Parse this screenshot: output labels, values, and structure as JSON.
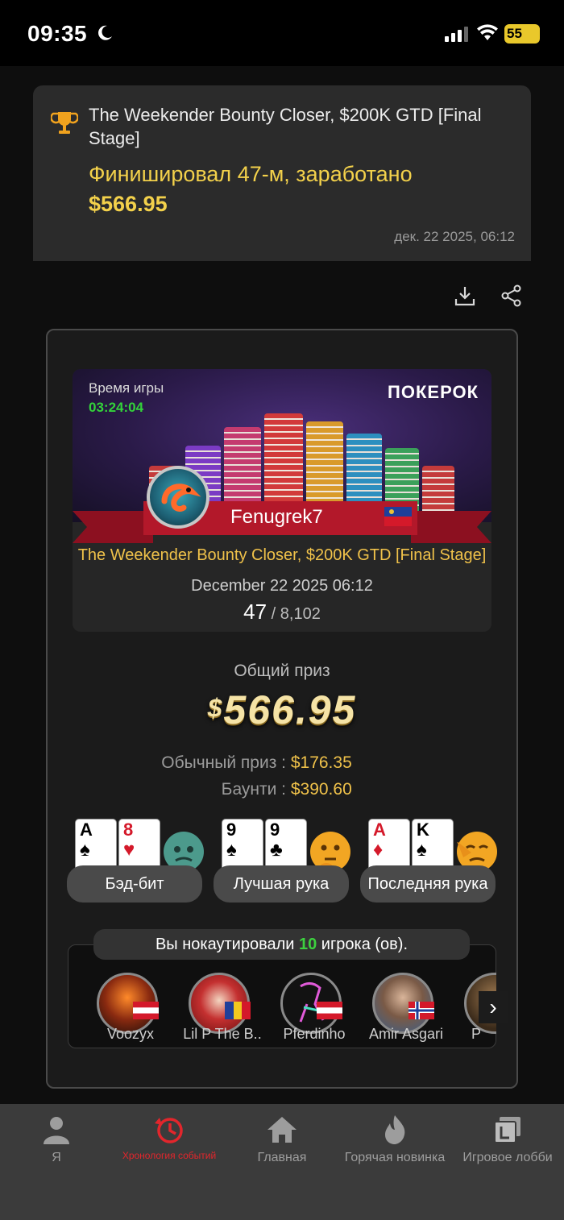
{
  "status_bar": {
    "time": "09:35",
    "battery": "55"
  },
  "notice": {
    "title": "The Weekender Bounty Closer, $200K GTD [Final Stage]",
    "result_text": "Финишировал 47-м, заработано",
    "result_amount": "$566.95",
    "date": "дек. 22 2025, 06:12"
  },
  "banner": {
    "playtime_label": "Время игры",
    "playtime": "03:24:04",
    "logo": "ПОКЕРОК",
    "player_name": "Fenugrek7",
    "tournament": "The Weekender Bounty Closer, $200K GTD [Final Stage]",
    "date": "December 22 2025 06:12",
    "place": "47",
    "field": " / 8,102"
  },
  "prize": {
    "label": "Общий приз",
    "currency": "$",
    "amount": "566.95",
    "regular_label": "Обычный приз :",
    "regular_value": "$176.35",
    "bounty_label": "Баунти :",
    "bounty_value": "$390.60"
  },
  "hands": [
    {
      "label": "Бэд-бит",
      "cards": [
        {
          "rank": "A",
          "suit": "♠",
          "red": false
        },
        {
          "rank": "8",
          "suit": "♥",
          "red": true
        }
      ]
    },
    {
      "label": "Лучшая рука",
      "cards": [
        {
          "rank": "9",
          "suit": "♠",
          "red": false
        },
        {
          "rank": "9",
          "suit": "♣",
          "red": false
        }
      ]
    },
    {
      "label": "Последняя рука",
      "cards": [
        {
          "rank": "A",
          "suit": "♦",
          "red": true
        },
        {
          "rank": "K",
          "suit": "♠",
          "red": false
        }
      ]
    }
  ],
  "knockouts": {
    "prefix": "Вы нокаутировали ",
    "count": "10",
    "suffix": " игрока (ов).",
    "players": [
      {
        "name": "Voozyx",
        "flag": "austria"
      },
      {
        "name": "Lil P The B..",
        "flag": "andorra"
      },
      {
        "name": "Pferdinho",
        "flag": "austria"
      },
      {
        "name": "Amir Asgari",
        "flag": "norway"
      },
      {
        "name": "P",
        "flag": ""
      }
    ]
  },
  "tabs": [
    {
      "label": "Я",
      "icon": "person-icon"
    },
    {
      "label": "Хронология событий",
      "icon": "history-icon",
      "active": true
    },
    {
      "label": "Главная",
      "icon": "home-icon"
    },
    {
      "label": "Горячая новинка",
      "icon": "fire-icon"
    },
    {
      "label": "Игровое лобби",
      "icon": "lobby-icon"
    }
  ],
  "colors": {
    "accent_gold": "#f0c24a",
    "accent_red": "#e2262c",
    "green": "#33d33a"
  }
}
